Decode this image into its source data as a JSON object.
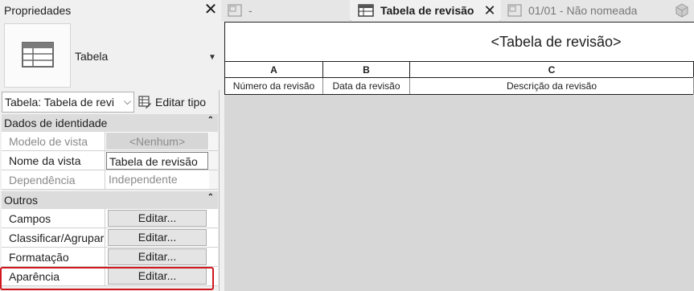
{
  "properties": {
    "title": "Propriedades",
    "type_name": "Tabela",
    "type_selector": "Tabela: Tabela de revi",
    "edit_type_label": "Editar tipo",
    "sections": [
      {
        "title": "Dados de identidade",
        "rows": [
          {
            "label": "Modelo de vista",
            "value": "<Nenhum>"
          },
          {
            "label": "Nome da vista",
            "value": "Tabela de revisão"
          },
          {
            "label": "Dependência",
            "value": "Independente"
          }
        ]
      },
      {
        "title": "Outros",
        "rows": [
          {
            "label": "Campos",
            "value": "Editar..."
          },
          {
            "label": "Classificar/Agrupar",
            "value": "Editar..."
          },
          {
            "label": "Formatação",
            "value": "Editar..."
          },
          {
            "label": "Aparência",
            "value": "Editar..."
          }
        ]
      }
    ]
  },
  "tabs": [
    {
      "label": "-",
      "icon": "sheet-icon"
    },
    {
      "label": "Tabela de revisão",
      "icon": "table-icon",
      "active": true
    },
    {
      "label": "01/01 - Não nomeada",
      "icon": "sheet-icon"
    }
  ],
  "schedule": {
    "title": "<Tabela de revisão>",
    "columns": [
      {
        "letter": "A",
        "header": "Número da revisão"
      },
      {
        "letter": "B",
        "header": "Data da revisão"
      },
      {
        "letter": "C",
        "header": "Descrição da revisão"
      }
    ]
  },
  "colors": {
    "highlight": "#d0181f",
    "section_bg": "#dcdcdc",
    "view_bg": "#d7d7d7"
  }
}
